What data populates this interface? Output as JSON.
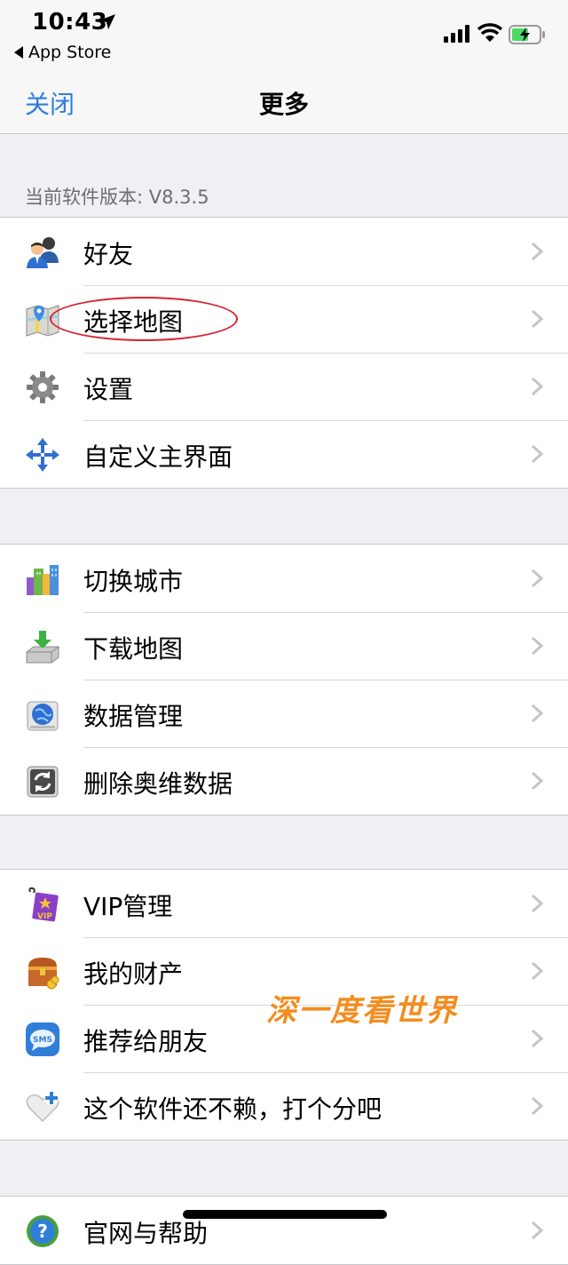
{
  "status_bar": {
    "time": "10:43",
    "back_app_label": "App Store",
    "icons": [
      "location-arrow-icon",
      "signal-icon",
      "wifi-icon",
      "battery-charging-icon"
    ]
  },
  "nav": {
    "close_label": "关闭",
    "title": "更多"
  },
  "version_text": "当前软件版本: V8.3.5",
  "groups": [
    {
      "items": [
        {
          "label": "好友",
          "icon": "friends-icon"
        },
        {
          "label": "选择地图",
          "icon": "map-icon"
        },
        {
          "label": "设置",
          "icon": "gear-icon"
        },
        {
          "label": "自定义主界面",
          "icon": "arrows-icon"
        }
      ]
    },
    {
      "items": [
        {
          "label": "切换城市",
          "icon": "city-icon"
        },
        {
          "label": "下载地图",
          "icon": "download-icon"
        },
        {
          "label": "数据管理",
          "icon": "globe-icon"
        },
        {
          "label": "删除奥维数据",
          "icon": "refresh-icon"
        }
      ]
    },
    {
      "items": [
        {
          "label": "VIP管理",
          "icon": "vip-icon"
        },
        {
          "label": "我的财产",
          "icon": "treasure-chest-icon"
        },
        {
          "label": "推荐给朋友",
          "icon": "sms-icon"
        },
        {
          "label": "这个软件还不赖，打个分吧",
          "icon": "heart-plus-icon"
        }
      ]
    },
    {
      "items": [
        {
          "label": "官网与帮助",
          "icon": "help-icon"
        }
      ]
    }
  ],
  "vip_badge": "VIP",
  "sms_badge": "SMS",
  "watermark": "深一度看世界",
  "colors": {
    "accent": "#2f7fd8",
    "annotation": "#d8202e",
    "watermark": "#f28d1e",
    "background": "#efeff4"
  }
}
